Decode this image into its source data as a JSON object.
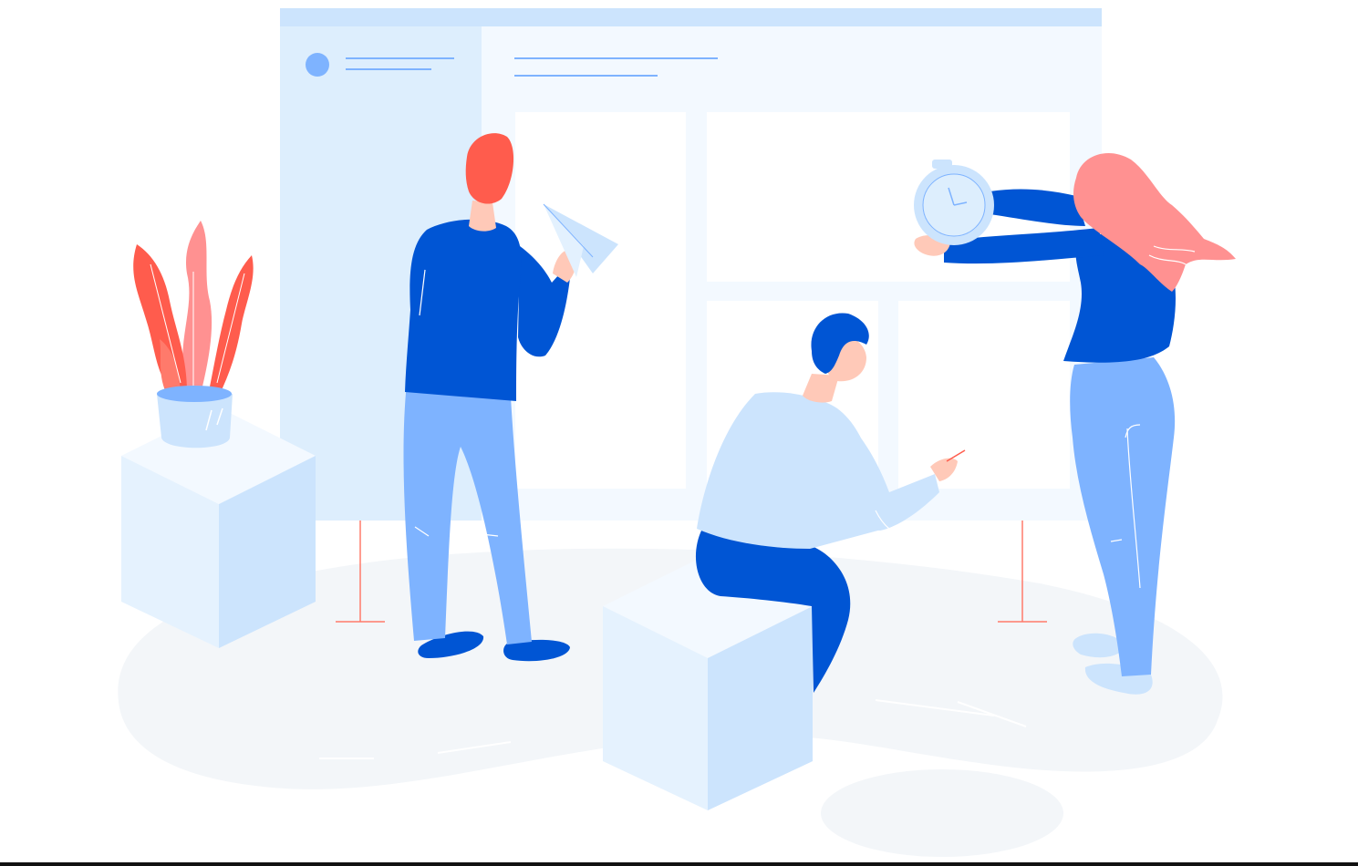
{
  "illustration": {
    "type": "team-collaboration-illustration",
    "colors": {
      "blue_dark": "#0055D4",
      "blue_mid": "#7EB3FF",
      "blue_light": "#CCE4FD",
      "blue_pale": "#E3F1FE",
      "board_bg": "#F3F9FF",
      "coral": "#FF5C4D",
      "pink": "#FF9191",
      "skin": "#FFC9B8",
      "ground": "#F3F6F9"
    },
    "icons": [
      "paper-plane-icon",
      "stopwatch-icon",
      "plant-icon"
    ]
  }
}
